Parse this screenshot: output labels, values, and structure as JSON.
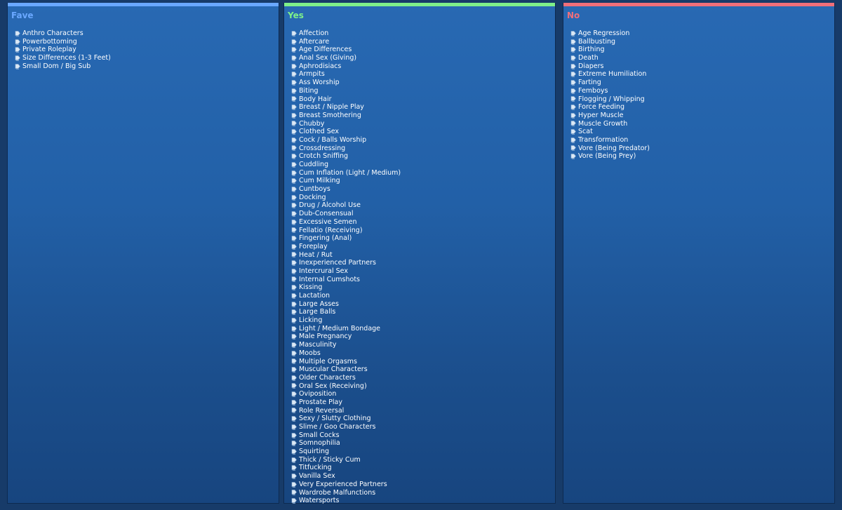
{
  "colors": {
    "fave": "#6aa8ff",
    "yes": "#7ef08a",
    "no": "#f06f7a",
    "item_text": "#ffffff"
  },
  "icon": "bullet-tag-icon",
  "columns": [
    {
      "id": "fave",
      "title": "Fave",
      "items": [
        "Anthro Characters",
        "Powerbottoming",
        "Private Roleplay",
        "Size Differences (1-3 Feet)",
        "Small Dom / Big Sub"
      ]
    },
    {
      "id": "yes",
      "title": "Yes",
      "items": [
        "Affection",
        "Aftercare",
        "Age Differences",
        "Anal Sex (Giving)",
        "Aphrodisiacs",
        "Armpits",
        "Ass Worship",
        "Biting",
        "Body Hair",
        "Breast / Nipple Play",
        "Breast Smothering",
        "Chubby",
        "Clothed Sex",
        "Cock / Balls Worship",
        "Crossdressing",
        "Crotch Sniffing",
        "Cuddling",
        "Cum Inflation (Light / Medium)",
        "Cum Milking",
        "Cuntboys",
        "Docking",
        "Drug / Alcohol Use",
        "Dub-Consensual",
        "Excessive Semen",
        "Fellatio (Receiving)",
        "Fingering (Anal)",
        "Foreplay",
        "Heat / Rut",
        "Inexperienced Partners",
        "Intercrural Sex",
        "Internal Cumshots",
        "Kissing",
        "Lactation",
        "Large Asses",
        "Large Balls",
        "Licking",
        "Light / Medium Bondage",
        "Male Pregnancy",
        "Masculinity",
        "Moobs",
        "Multiple Orgasms",
        "Muscular Characters",
        "Older Characters",
        "Oral Sex (Receiving)",
        "Oviposition",
        "Prostate Play",
        "Role Reversal",
        "Sexy / Slutty Clothing",
        "Slime / Goo Characters",
        "Small Cocks",
        "Somnophilia",
        "Squirting",
        "Thick / Sticky Cum",
        "Titfucking",
        "Vanilla Sex",
        "Very Experienced Partners",
        "Wardrobe Malfunctions",
        "Watersports"
      ]
    },
    {
      "id": "no",
      "title": "No",
      "items": [
        "Age Regression",
        "Ballbusting",
        "Birthing",
        "Death",
        "Diapers",
        "Extreme Humiliation",
        "Farting",
        "Femboys",
        "Flogging / Whipping",
        "Force Feeding",
        "Hyper Muscle",
        "Muscle Growth",
        "Scat",
        "Transformation",
        "Vore (Being Predator)",
        "Vore (Being Prey)"
      ]
    }
  ]
}
